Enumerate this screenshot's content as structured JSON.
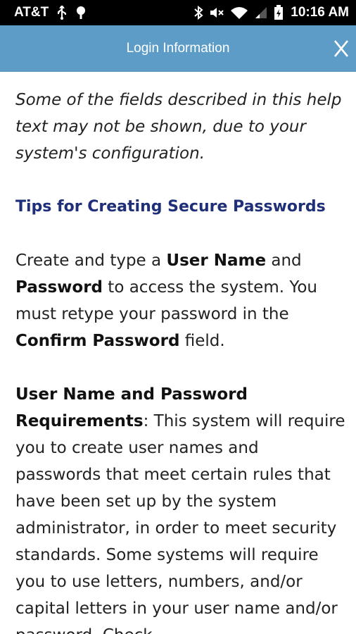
{
  "status_bar": {
    "carrier": "AT&T",
    "time": "10:16 AM",
    "icons": [
      "usb-icon",
      "android-icon",
      "bluetooth-icon",
      "mute-icon",
      "wifi-icon",
      "signal-icon",
      "battery-icon"
    ]
  },
  "header": {
    "title": "Login Information",
    "close_label": "X"
  },
  "content": {
    "note": "Some of the fields described in this help text may not be shown, due to your system's configuration.",
    "heading": "Tips for Creating Secure Passwords",
    "para1": {
      "t1": "Create and type a ",
      "b1": "User Name",
      "t2": " and ",
      "b2": "Password",
      "t3": " to access the system. You must retype your password in the ",
      "b3": "Confirm Password",
      "t4": " field."
    },
    "para2": {
      "b1": "User Name and Password Requirements",
      "t1": ": This system will require you to create user names and passwords that meet certain rules that have been set up by the system administrator, in order to meet security standards. Some systems will require you to use letters, numbers, and/or capital letters in your user name and/or password. Check"
    }
  },
  "colors": {
    "status_bar": "#000000",
    "title_bar": "#5d9cc7",
    "heading": "#1f2f78",
    "text": "#222222"
  }
}
